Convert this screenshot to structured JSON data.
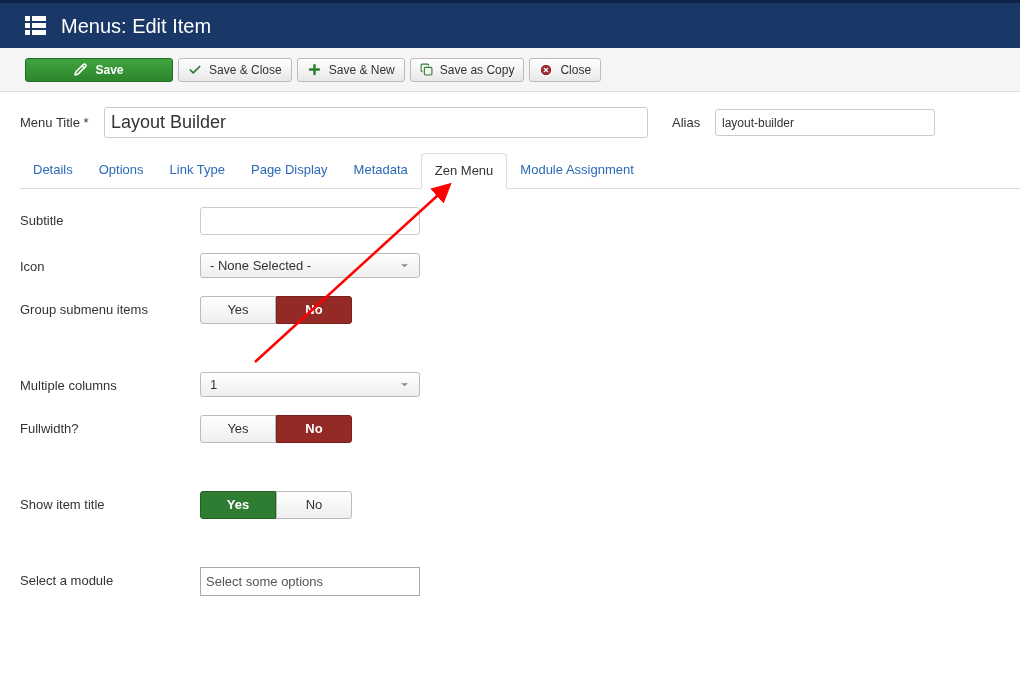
{
  "header": {
    "title": "Menus: Edit Item"
  },
  "toolbar": [
    {
      "label": "Save",
      "kind": "primary"
    },
    {
      "label": "Save & Close",
      "kind": "check"
    },
    {
      "label": "Save & New",
      "kind": "plus"
    },
    {
      "label": "Save as Copy",
      "kind": "copy"
    },
    {
      "label": "Close",
      "kind": "close"
    }
  ],
  "title_field": {
    "label": "Menu Title *",
    "value": "Layout Builder"
  },
  "alias_field": {
    "label": "Alias",
    "value": "layout-builder"
  },
  "tabs": [
    {
      "label": "Details",
      "selected": false
    },
    {
      "label": "Options",
      "selected": false
    },
    {
      "label": "Link Type",
      "selected": false
    },
    {
      "label": "Page Display",
      "selected": false
    },
    {
      "label": "Metadata",
      "selected": false
    },
    {
      "label": "Zen Menu",
      "selected": true
    },
    {
      "label": "Module Assignment",
      "selected": false
    }
  ],
  "fields": [
    {
      "label": "Subtitle",
      "kind": "text"
    },
    {
      "label": "Icon",
      "kind": "select",
      "value": "- None Selected -"
    },
    {
      "label": "Group submenu items",
      "kind": "toggle",
      "options": [
        {
          "label": "Yes",
          "selected": false
        },
        {
          "label": "No",
          "selected": true
        }
      ]
    },
    {
      "label": "Multiple columns",
      "kind": "select",
      "value": "1"
    },
    {
      "label": "Fullwidth?",
      "kind": "toggle",
      "options": [
        {
          "label": "Yes",
          "selected": false
        },
        {
          "label": "No",
          "selected": true
        }
      ]
    },
    {
      "label": "Show item title",
      "kind": "toggle",
      "options": [
        {
          "label": "Yes",
          "selected": true
        },
        {
          "label": "No",
          "selected": false
        }
      ]
    },
    {
      "label": "Select a module",
      "kind": "multiselect",
      "placeholder": "Select some options"
    }
  ]
}
